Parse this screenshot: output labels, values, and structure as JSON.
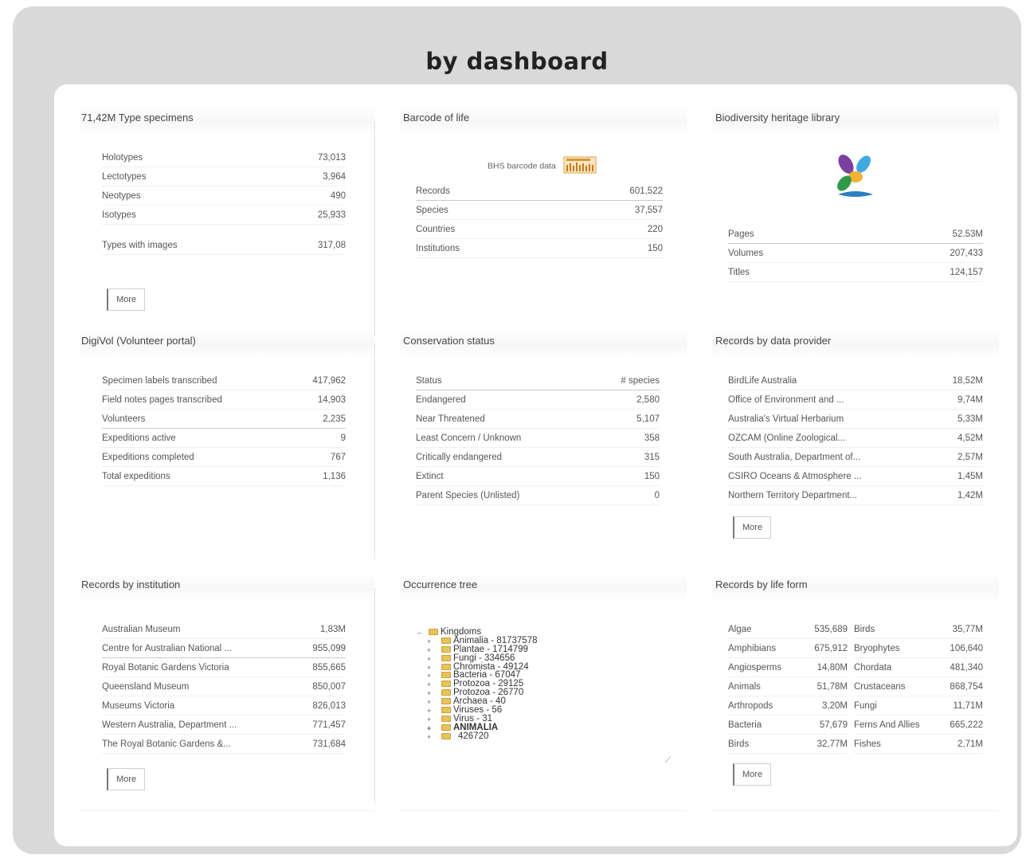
{
  "page": {
    "title": "by dashboard"
  },
  "type_specimens": {
    "title": "71,42M Type specimens",
    "rows": [
      {
        "label": "Holotypes",
        "value": "73,013"
      },
      {
        "label": "Lectotypes",
        "value": "3,964"
      },
      {
        "label": "Neotypes",
        "value": "490"
      },
      {
        "label": "Isotypes",
        "value": "25,933"
      },
      {
        "label": "Types with images",
        "value": "317,08"
      }
    ],
    "more": "More"
  },
  "barcode": {
    "title": "Barcode of life",
    "source": "BHS barcode data",
    "rows": [
      {
        "label": "Records",
        "value": "601,522"
      },
      {
        "label": "Species",
        "value": "37,557"
      },
      {
        "label": "Countries",
        "value": "220"
      },
      {
        "label": "Institutions",
        "value": "150"
      }
    ]
  },
  "bhl": {
    "title": "Biodiversity heritage library",
    "rows": [
      {
        "label": "Pages",
        "value": "52.53M"
      },
      {
        "label": "Volumes",
        "value": "207,433"
      },
      {
        "label": "Titles",
        "value": "124,157"
      }
    ]
  },
  "digivol": {
    "title": "DigiVol (Volunteer portal)",
    "rows": [
      {
        "label": "Specimen labels transcribed",
        "value": "417,962"
      },
      {
        "label": "Field notes pages transcribed",
        "value": "14,903"
      },
      {
        "label": "Volunteers",
        "value": "2,235"
      },
      {
        "label": "Expeditions active",
        "value": "9"
      },
      {
        "label": "Expeditions completed",
        "value": "767"
      },
      {
        "label": "Total expeditions",
        "value": "1,136"
      }
    ]
  },
  "conservation": {
    "title": "Conservation status",
    "header": {
      "label": "Status",
      "value": "# species"
    },
    "rows": [
      {
        "label": "Endangered",
        "value": "2,580"
      },
      {
        "label": "Near Threatened",
        "value": "5,107"
      },
      {
        "label": "Least Concern / Unknown",
        "value": "358"
      },
      {
        "label": "Critically endangered",
        "value": "315"
      },
      {
        "label": "Extinct",
        "value": "150"
      },
      {
        "label": "Parent Species (Unlisted)",
        "value": "0"
      }
    ]
  },
  "data_provider": {
    "title": "Records by data provider",
    "rows": [
      {
        "label": "BirdLife Australia",
        "value": "18,52M"
      },
      {
        "label": "Office of Environment and ...",
        "value": "9,74M"
      },
      {
        "label": "Australia's Virtual Herbarium",
        "value": "5,33M"
      },
      {
        "label": "OZCAM (Online Zoological...",
        "value": "4,52M"
      },
      {
        "label": "South Australia, Department of...",
        "value": "2,57M"
      },
      {
        "label": "CSIRO Oceans & Atmosphere ...",
        "value": "1,45M"
      },
      {
        "label": "Northern Territory Department...",
        "value": "1,42M"
      }
    ],
    "more": "More"
  },
  "institution": {
    "title": "Records by institution",
    "rows": [
      {
        "label": "Australian Museum",
        "value": "1,83M"
      },
      {
        "label": "Centre for Australian National ...",
        "value": "955,099"
      },
      {
        "label": "Royal Botanic Gardens Victoria",
        "value": "855,665"
      },
      {
        "label": "Queensland Museum",
        "value": "850,007"
      },
      {
        "label": "Museums Victoria",
        "value": "826,013"
      },
      {
        "label": "Western Australia, Department ...",
        "value": "771,457"
      },
      {
        "label": "The Royal Botanic Gardens &...",
        "value": "731,684"
      }
    ],
    "more": "More"
  },
  "tree": {
    "title": "Occurrence tree",
    "root": "Kingdoms",
    "nodes": [
      "Animalia - 81737578",
      "Plantae - 1714799",
      "Fungi - 334656",
      "Chromista - 49124",
      "Bacteria - 67047",
      "Protozoa - 29125",
      "Protozoa - 26770",
      "Archaea - 40",
      "Viruses - 56",
      "Virus - 31",
      "ANIMALIA",
      "426720"
    ]
  },
  "life_form": {
    "title": "Records by life form",
    "left": [
      {
        "label": "Algae",
        "value": "535,689"
      },
      {
        "label": "Amphibians",
        "value": "675,912"
      },
      {
        "label": "Angiosperms",
        "value": "14,80M"
      },
      {
        "label": "Animals",
        "value": "51,78M"
      },
      {
        "label": "Arthropods",
        "value": "3,20M"
      },
      {
        "label": "Bacteria",
        "value": "57,679"
      },
      {
        "label": "Birds",
        "value": "32,77M"
      }
    ],
    "right": [
      {
        "label": "Birds",
        "value": "35,77M"
      },
      {
        "label": "Bryophytes",
        "value": "106,640"
      },
      {
        "label": "Chordata",
        "value": "481,340"
      },
      {
        "label": "Crustaceans",
        "value": "868,754"
      },
      {
        "label": "Fungi",
        "value": "11,71M"
      },
      {
        "label": "Ferns And Allies",
        "value": "665,222"
      },
      {
        "label": "Fishes",
        "value": "2,71M"
      }
    ],
    "more": "More"
  }
}
